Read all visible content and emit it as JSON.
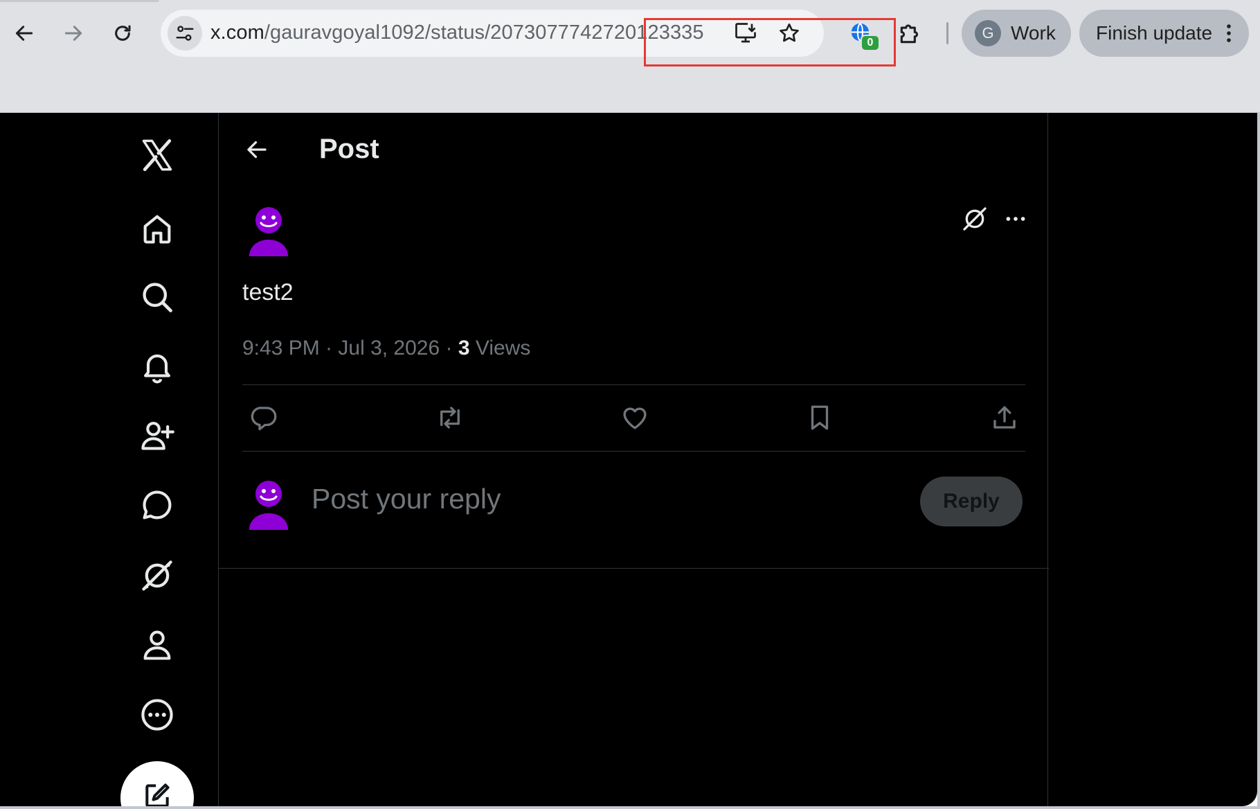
{
  "browser": {
    "url_host": "x.com",
    "url_path_prefix": "/gauravgoyal1092/statu",
    "url_path_highlight": "s/2073077742720123335",
    "extension_badge": "0",
    "profile": {
      "initial": "G",
      "label": "Work"
    },
    "update_button": "Finish update",
    "colors": {
      "highlight_box": "#e53935",
      "badge": "#2e9e3f"
    }
  },
  "sidebar": {
    "logo": "x-logo-icon",
    "items": [
      "home-icon",
      "search-icon",
      "bell-icon",
      "person-add-icon",
      "chat-bubble-icon",
      "grok-icon",
      "profile-icon",
      "more-circle-icon"
    ],
    "compose": "compose-icon"
  },
  "header": {
    "title": "Post"
  },
  "post": {
    "text": "test2",
    "time_date": "9:43 PM · Jul 3, 2026 · ",
    "views_count": "3",
    "views_label": " Views",
    "avatar_color": "#8e00d6",
    "actions": [
      "reply-icon",
      "repost-icon",
      "like-icon",
      "bookmark-icon",
      "share-icon"
    ]
  },
  "reply": {
    "placeholder": "Post your reply",
    "button": "Reply"
  }
}
